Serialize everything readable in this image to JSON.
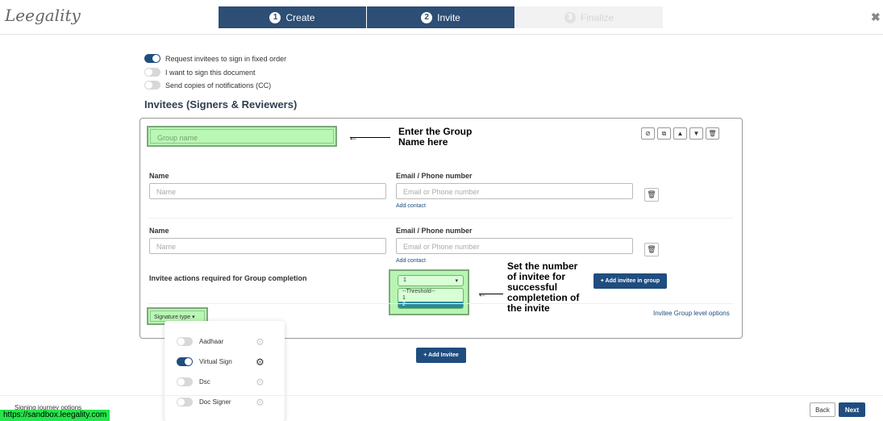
{
  "header": {
    "logo": "Leegality",
    "steps": [
      {
        "num": "1",
        "label": "Create"
      },
      {
        "num": "2",
        "label": "Invite"
      },
      {
        "num": "3",
        "label": "Finalize"
      }
    ],
    "close_icon": "close-icon"
  },
  "options": {
    "fixed_order": {
      "label": "Request invitees to sign in fixed order",
      "on": true
    },
    "sign_doc": {
      "label": "I want to sign this document",
      "on": false
    },
    "cc": {
      "label": "Send copies of notifications (CC)",
      "on": false
    }
  },
  "section_title": "Invitees (Signers & Reviewers)",
  "group": {
    "name_placeholder": "Group name",
    "annotation_group": [
      "Enter the Group",
      "Name here"
    ],
    "icons": [
      "check-circle-icon",
      "copy-icon",
      "caret-up-icon",
      "caret-down-icon",
      "trash-icon"
    ],
    "invitees": [
      {
        "name_label": "Name",
        "name_placeholder": "Name",
        "email_label": "Email / Phone number",
        "email_placeholder": "Email or Phone number",
        "add_contact": "Add contact"
      },
      {
        "name_label": "Name",
        "name_placeholder": "Name",
        "email_label": "Email / Phone number",
        "email_placeholder": "Email or Phone number",
        "add_contact": "Add contact"
      }
    ],
    "threshold_label": "Invitee actions required for Group completion",
    "threshold_value": "1",
    "threshold_options": [
      "--Threshold--",
      "1",
      "2"
    ],
    "annotation_threshold": [
      "Set the number",
      "of invitee for",
      "successful",
      "completetion of",
      "the invite"
    ],
    "add_invitee_in_group": "+ Add invitee in group",
    "group_level_options": "Invitee Group level options",
    "signature_type": "Signature type ▾"
  },
  "signature_popup": [
    {
      "label": "Aadhaar",
      "on": false
    },
    {
      "label": "Virtual Sign",
      "on": true
    },
    {
      "label": "Dsc",
      "on": false
    },
    {
      "label": "Doc Signer",
      "on": false
    }
  ],
  "add_invitee": "+ Add Invitee",
  "footer": {
    "journey": "Signing journey options",
    "url": "https://sandbox.leegality.com",
    "back": "Back",
    "next": "Next"
  },
  "colors": {
    "primary": "#1f4d7f",
    "highlight": "#b7f5b3"
  }
}
